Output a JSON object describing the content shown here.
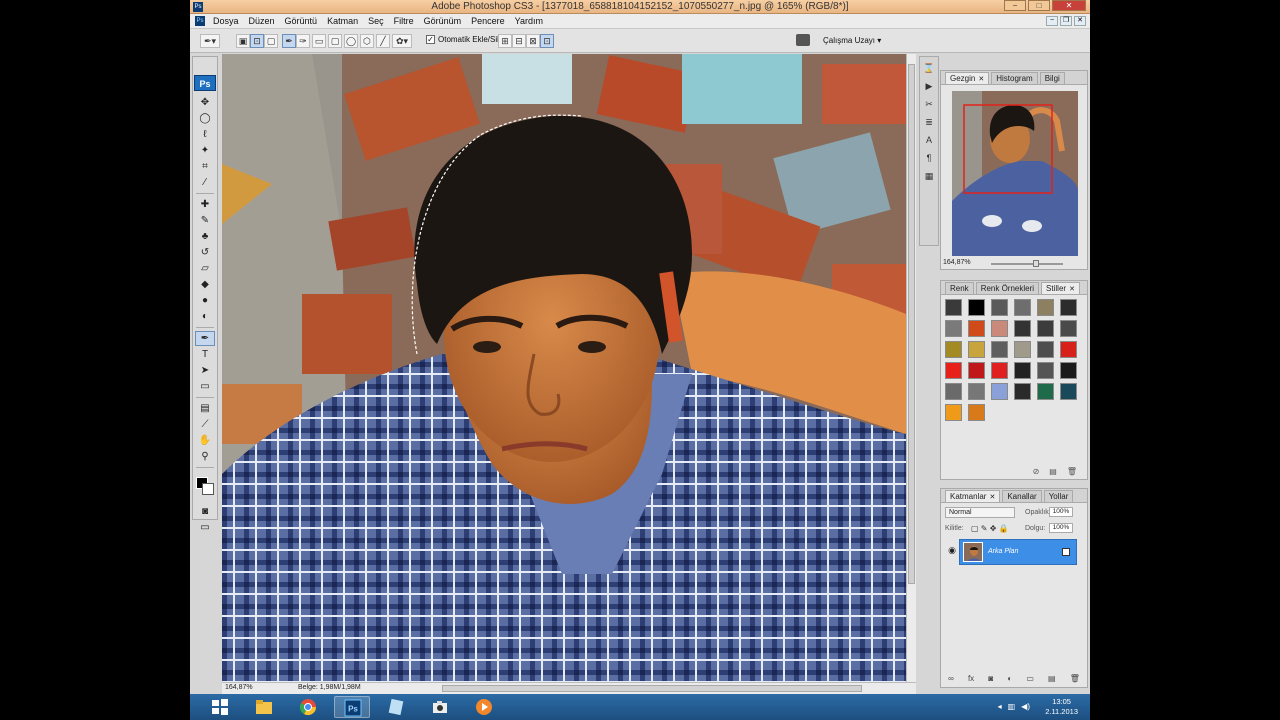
{
  "window": {
    "title": "Adobe Photoshop CS3 - [1377018_658818104152152_1070550277_n.jpg @ 165% (RGB/8*)]",
    "app_badge": "Ps",
    "buttons": {
      "minimize": "−",
      "maximize": "□",
      "close": "✕"
    }
  },
  "menubar": {
    "items": [
      "Dosya",
      "Düzen",
      "Görüntü",
      "Katman",
      "Seç",
      "Filtre",
      "Görünüm",
      "Pencere",
      "Yardım"
    ]
  },
  "options_bar": {
    "auto_add_label": "Otomatik Ekle/Sil",
    "auto_add_checked": "✓",
    "workspace_label": "Çalışma Uzayı ▾"
  },
  "toolbox": {
    "logo": "Ps",
    "active_tool": "pen-tool",
    "tools": [
      {
        "name": "move-tool",
        "glyph": "✥"
      },
      {
        "name": "marquee-tool",
        "glyph": "◯"
      },
      {
        "name": "lasso-tool",
        "glyph": "ℓ"
      },
      {
        "name": "magic-wand-tool",
        "glyph": "✦"
      },
      {
        "name": "crop-tool",
        "glyph": "⌗"
      },
      {
        "name": "slice-tool",
        "glyph": "⁄"
      },
      {
        "name": "healing-brush-tool",
        "glyph": "✚"
      },
      {
        "name": "brush-tool",
        "glyph": "✎"
      },
      {
        "name": "clone-stamp-tool",
        "glyph": "♣"
      },
      {
        "name": "history-brush-tool",
        "glyph": "↺"
      },
      {
        "name": "eraser-tool",
        "glyph": "▱"
      },
      {
        "name": "paint-bucket-tool",
        "glyph": "◆"
      },
      {
        "name": "blur-tool",
        "glyph": "●"
      },
      {
        "name": "dodge-tool",
        "glyph": "◐"
      },
      {
        "name": "pen-tool",
        "glyph": "✒"
      },
      {
        "name": "type-tool",
        "glyph": "T"
      },
      {
        "name": "path-selection-tool",
        "glyph": "➤"
      },
      {
        "name": "rectangle-tool",
        "glyph": "▭"
      },
      {
        "name": "notes-tool",
        "glyph": "▤"
      },
      {
        "name": "eyedropper-tool",
        "glyph": "⟋"
      },
      {
        "name": "hand-tool",
        "glyph": "✋"
      },
      {
        "name": "zoom-tool",
        "glyph": "⚲"
      }
    ]
  },
  "status_bar": {
    "zoom": "164,87%",
    "doc_info": "Belge: 1,98M/1,98M"
  },
  "navigator_panel": {
    "tabs": [
      "Gezgin",
      "Histogram",
      "Bilgi"
    ],
    "active_tab": "Gezgin",
    "zoom": "164,87%"
  },
  "styles_panel": {
    "tabs": [
      "Renk",
      "Renk Örnekleri",
      "Stiller"
    ],
    "active_tab": "Stiller",
    "swatches": [
      "#3a3a3a",
      "#000000",
      "#5a5a5a",
      "#6e6e6e",
      "#8c8060",
      "#2c2c2c",
      "#7a7a7a",
      "#d14a1a",
      "#c98a7a",
      "#333333",
      "#3c3c3c",
      "#4a4a4a",
      "#a38a22",
      "#c8a43c",
      "#5e5e5e",
      "#a09a8a",
      "#4e4e4e",
      "#d8201a",
      "#e8201a",
      "#c01818",
      "#e02020",
      "#222222",
      "#555555",
      "#1a1a1a",
      "#6a6a6a",
      "#777777",
      "#8aa0d8",
      "#2a2a2a",
      "#1e6a4a",
      "#1a4a5a",
      "#f09a1a",
      "#d87a1a"
    ]
  },
  "layers_panel": {
    "tabs": [
      "Katmanlar",
      "Kanallar",
      "Yollar"
    ],
    "active_tab": "Katmanlar",
    "blend_mode": "Normal",
    "opacity_label": "Opaklık:",
    "opacity_value": "100%",
    "lock_label": "Kilitle:",
    "fill_label": "Dolgu:",
    "fill_value": "100%",
    "layers": [
      {
        "name": "Arka Plan",
        "visible": true,
        "locked": true
      }
    ]
  },
  "taskbar": {
    "time": "13:05",
    "date": "2.11.2013",
    "items": [
      "start",
      "file-explorer",
      "chrome",
      "photoshop",
      "notes",
      "camera",
      "media-player"
    ],
    "active_item": "photoshop"
  }
}
